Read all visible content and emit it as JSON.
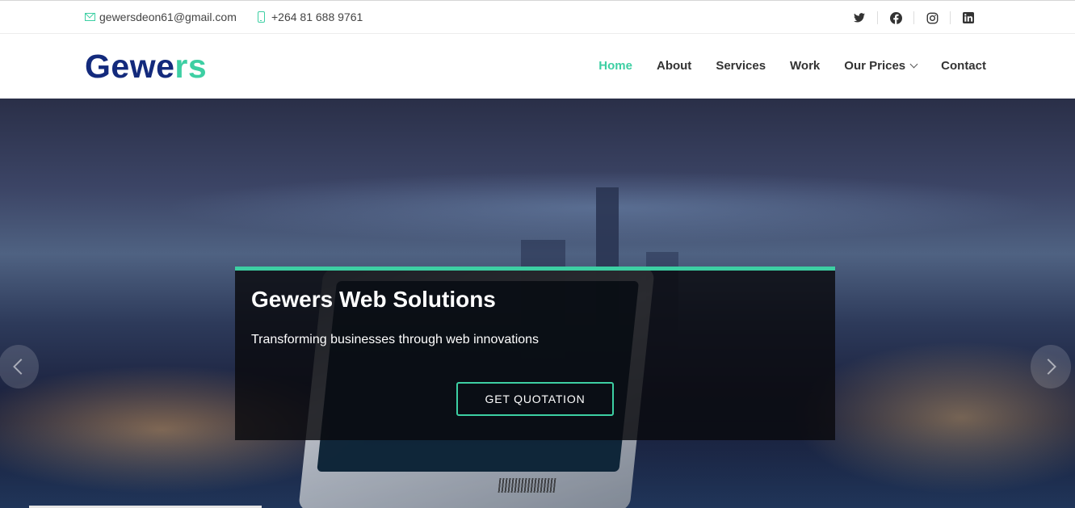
{
  "topbar": {
    "email": "gewersdeon61@gmail.com",
    "phone": "+264 81 688 9761",
    "social": [
      "twitter-icon",
      "facebook-icon",
      "instagram-icon",
      "linkedin-icon"
    ]
  },
  "header": {
    "logo_main": "Gewe",
    "logo_accent": "rs",
    "nav": [
      {
        "label": "Home",
        "active": true
      },
      {
        "label": "About"
      },
      {
        "label": "Services"
      },
      {
        "label": "Work"
      },
      {
        "label": "Our Prices",
        "dropdown": true
      },
      {
        "label": "Contact"
      }
    ]
  },
  "hero": {
    "title": "Gewers Web Solutions",
    "subtitle": "Transforming businesses through web innovations",
    "cta": "GET QUOTATION"
  },
  "colors": {
    "accent": "#3dcfa3",
    "brand": "#132a7c",
    "caption_bg": "#0a0a0e"
  }
}
